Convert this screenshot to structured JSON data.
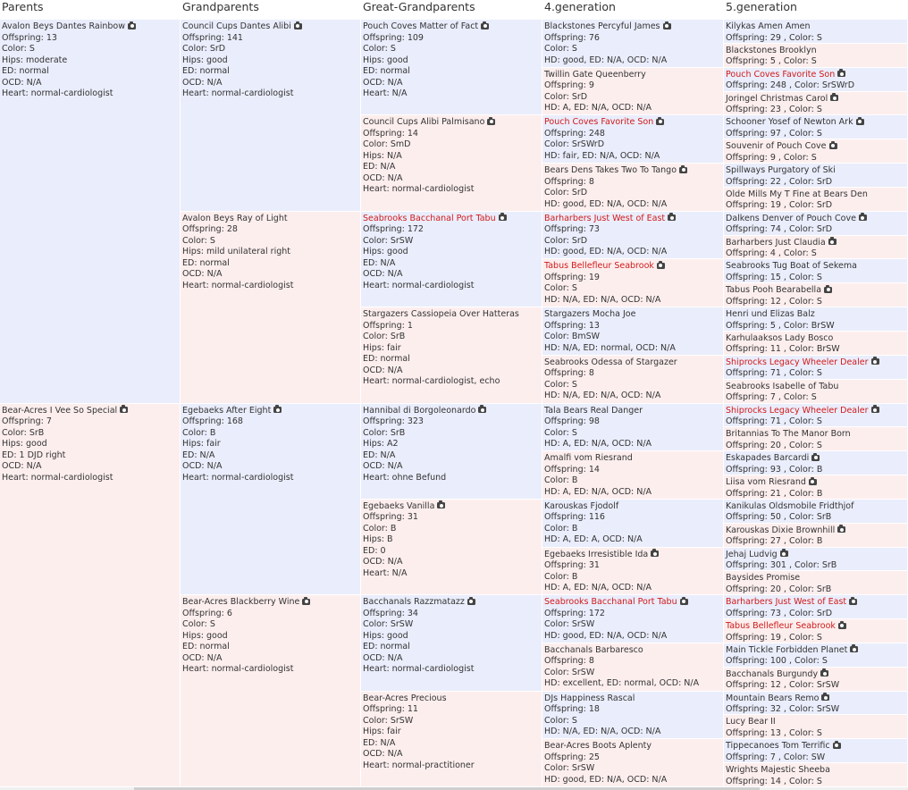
{
  "headers": [
    "Parents",
    "Grandparents",
    "Great-Grandparents",
    "4.generation",
    "5.generation"
  ],
  "gen1": [
    {
      "name": "Avalon Beys Dantes Rainbow",
      "photo": true,
      "red": false,
      "lines": [
        "Offspring: 13",
        "Color: S",
        "Hips: moderate",
        "ED: normal",
        "OCD: N/A",
        "Heart: normal-cardiologist"
      ]
    },
    {
      "name": "Bear-Acres I Vee So Special",
      "photo": true,
      "red": false,
      "lines": [
        "Offspring: 7",
        "Color: SrB",
        "Hips: good",
        "ED: 1 DJD right",
        "OCD: N/A",
        "Heart: normal-cardiologist"
      ]
    }
  ],
  "gen2": [
    {
      "name": "Council Cups Dantes Alibi",
      "photo": true,
      "red": false,
      "lines": [
        "Offspring: 141",
        "Color: SrD",
        "Hips: good",
        "ED: normal",
        "OCD: N/A",
        "Heart: normal-cardiologist"
      ]
    },
    {
      "name": "Avalon Beys Ray of Light",
      "photo": false,
      "red": false,
      "lines": [
        "Offspring: 28",
        "Color: S",
        "Hips: mild unilateral right",
        "ED: normal",
        "OCD: N/A",
        "Heart: normal-cardiologist"
      ]
    },
    {
      "name": "Egebaeks After Eight",
      "photo": true,
      "red": false,
      "lines": [
        "Offspring: 168",
        "Color: B",
        "Hips: fair",
        "ED: N/A",
        "OCD: N/A",
        "Heart: normal-cardiologist"
      ]
    },
    {
      "name": "Bear-Acres Blackberry Wine",
      "photo": true,
      "red": false,
      "lines": [
        "Offspring: 6",
        "Color: S",
        "Hips: good",
        "ED: normal",
        "OCD: N/A",
        "Heart: normal-cardiologist"
      ]
    }
  ],
  "gen3": [
    {
      "name": "Pouch Coves Matter of Fact",
      "photo": true,
      "red": false,
      "lines": [
        "Offspring: 109",
        "Color: S",
        "Hips: good",
        "ED: normal",
        "OCD: N/A",
        "Heart: N/A"
      ]
    },
    {
      "name": "Council Cups Alibi Palmisano",
      "photo": true,
      "red": false,
      "lines": [
        "Offspring: 14",
        "Color: SmD",
        "Hips: N/A",
        "ED: N/A",
        "OCD: N/A",
        "Heart: normal-cardiologist"
      ]
    },
    {
      "name": "Seabrooks Bacchanal Port Tabu",
      "photo": true,
      "red": true,
      "lines": [
        "Offspring: 172",
        "Color: SrSW",
        "Hips: good",
        "ED: N/A",
        "OCD: N/A",
        "Heart: normal-cardiologist"
      ]
    },
    {
      "name": "Stargazers Cassiopeia Over Hatteras",
      "photo": false,
      "red": false,
      "lines": [
        "Offspring: 1",
        "Color: SrB",
        "Hips: fair",
        "ED: normal",
        "OCD: N/A",
        "Heart: normal-cardiologist, echo"
      ]
    },
    {
      "name": "Hannibal di Borgoleonardo",
      "photo": true,
      "red": false,
      "lines": [
        "Offspring: 323",
        "Color: SrB",
        "Hips: A2",
        "ED: N/A",
        "OCD: N/A",
        "Heart: ohne Befund"
      ]
    },
    {
      "name": "Egebaeks Vanilla",
      "photo": true,
      "red": false,
      "lines": [
        "Offspring: 31",
        "Color: B",
        "Hips: B",
        "ED: 0",
        "OCD: N/A",
        "Heart: N/A"
      ]
    },
    {
      "name": "Bacchanals Razzmatazz",
      "photo": true,
      "red": false,
      "lines": [
        "Offspring: 34",
        "Color: SrSW",
        "Hips: good",
        "ED: normal",
        "OCD: N/A",
        "Heart: normal-cardiologist"
      ]
    },
    {
      "name": "Bear-Acres Precious",
      "photo": false,
      "red": false,
      "lines": [
        "Offspring: 11",
        "Color: SrSW",
        "Hips: fair",
        "ED: N/A",
        "OCD: N/A",
        "Heart: normal-practitioner"
      ]
    }
  ],
  "gen4": [
    {
      "name": "Blackstones Percyful James",
      "photo": true,
      "red": false,
      "lines": [
        "Offspring: 76",
        "Color: S",
        "HD: good, ED: N/A, OCD: N/A"
      ]
    },
    {
      "name": "Twillin Gate Queenberry",
      "photo": false,
      "red": false,
      "lines": [
        "Offspring: 9",
        "Color: SrD",
        "HD: A, ED: N/A, OCD: N/A"
      ]
    },
    {
      "name": "Pouch Coves Favorite Son",
      "photo": true,
      "red": true,
      "lines": [
        "Offspring: 248",
        "Color: SrSWrD",
        "HD: fair, ED: N/A, OCD: N/A"
      ]
    },
    {
      "name": "Bears Dens Takes Two To Tango",
      "photo": true,
      "red": false,
      "lines": [
        "Offspring: 8",
        "Color: SrD",
        "HD: good, ED: N/A, OCD: N/A"
      ]
    },
    {
      "name": "Barharbers Just West of East",
      "photo": true,
      "red": true,
      "lines": [
        "Offspring: 73",
        "Color: SrD",
        "HD: good, ED: N/A, OCD: N/A"
      ]
    },
    {
      "name": "Tabus Bellefleur Seabrook",
      "photo": true,
      "red": true,
      "lines": [
        "Offspring: 19",
        "Color: S",
        "HD: N/A, ED: N/A, OCD: N/A"
      ]
    },
    {
      "name": "Stargazers Mocha Joe",
      "photo": false,
      "red": false,
      "lines": [
        "Offspring: 13",
        "Color: BmSW",
        "HD: N/A, ED: normal, OCD: N/A"
      ]
    },
    {
      "name": "Seabrooks Odessa of Stargazer",
      "photo": false,
      "red": false,
      "lines": [
        "Offspring: 8",
        "Color: S",
        "HD: N/A, ED: N/A, OCD: N/A"
      ]
    },
    {
      "name": "Tala Bears Real Danger",
      "photo": false,
      "red": false,
      "lines": [
        "Offspring: 98",
        "Color: S",
        "HD: A, ED: N/A, OCD: N/A"
      ]
    },
    {
      "name": "Amalfi vom Riesrand",
      "photo": false,
      "red": false,
      "lines": [
        "Offspring: 14",
        "Color: B",
        "HD: A, ED: N/A, OCD: N/A"
      ]
    },
    {
      "name": "Karouskas Fjodolf",
      "photo": false,
      "red": false,
      "lines": [
        "Offspring: 116",
        "Color: B",
        "HD: A, ED: A, OCD: N/A"
      ]
    },
    {
      "name": "Egebaeks Irresistible Ida",
      "photo": true,
      "red": false,
      "lines": [
        "Offspring: 31",
        "Color: B",
        "HD: A, ED: N/A, OCD: N/A"
      ]
    },
    {
      "name": "Seabrooks Bacchanal Port Tabu",
      "photo": true,
      "red": true,
      "lines": [
        "Offspring: 172",
        "Color: SrSW",
        "HD: good, ED: N/A, OCD: N/A"
      ]
    },
    {
      "name": "Bacchanals Barbaresco",
      "photo": false,
      "red": false,
      "lines": [
        "Offspring: 8",
        "Color: SrSW",
        "HD: excellent, ED: normal, OCD: N/A"
      ]
    },
    {
      "name": "DJs Happiness Rascal",
      "photo": false,
      "red": false,
      "lines": [
        "Offspring: 18",
        "Color: S",
        "HD: N/A, ED: N/A, OCD: N/A"
      ]
    },
    {
      "name": "Bear-Acres Boots Aplenty",
      "photo": false,
      "red": false,
      "lines": [
        "Offspring: 25",
        "Color: SrSW",
        "HD: good, ED: N/A, OCD: N/A"
      ]
    }
  ],
  "gen5": [
    {
      "name": "Kilykas Amen Amen",
      "photo": false,
      "red": false,
      "lines": [
        "Offspring: 29 , Color: S"
      ]
    },
    {
      "name": "Blackstones Brooklyn",
      "photo": false,
      "red": false,
      "lines": [
        "Offspring: 5 , Color: S"
      ]
    },
    {
      "name": "Pouch Coves Favorite Son",
      "photo": true,
      "red": true,
      "lines": [
        "Offspring: 248 , Color: SrSWrD"
      ]
    },
    {
      "name": "Joringel Christmas Carol",
      "photo": true,
      "red": false,
      "lines": [
        "Offspring: 23 , Color: S"
      ]
    },
    {
      "name": "Schooner Yosef of Newton Ark",
      "photo": true,
      "red": false,
      "lines": [
        "Offspring: 97 , Color: S"
      ]
    },
    {
      "name": "Souvenir of Pouch Cove",
      "photo": true,
      "red": false,
      "lines": [
        "Offspring: 9 , Color: S"
      ]
    },
    {
      "name": "Spillways Purgatory of Ski",
      "photo": false,
      "red": false,
      "lines": [
        "Offspring: 22 , Color: SrD"
      ]
    },
    {
      "name": "Olde Mills My T Fine at Bears Den",
      "photo": false,
      "red": false,
      "lines": [
        "Offspring: 19 , Color: SrD"
      ]
    },
    {
      "name": "Dalkens Denver of Pouch Cove",
      "photo": true,
      "red": false,
      "lines": [
        "Offspring: 74 , Color: SrD"
      ]
    },
    {
      "name": "Barharbers Just Claudia",
      "photo": true,
      "red": false,
      "lines": [
        "Offspring: 4 , Color: S"
      ]
    },
    {
      "name": "Seabrooks Tug Boat of Sekema",
      "photo": false,
      "red": false,
      "lines": [
        "Offspring: 15 , Color: S"
      ]
    },
    {
      "name": "Tabus Pooh Bearabella",
      "photo": true,
      "red": false,
      "lines": [
        "Offspring: 12 , Color: S"
      ]
    },
    {
      "name": "Henri und Elizas Balz",
      "photo": false,
      "red": false,
      "lines": [
        "Offspring: 5 , Color: BrSW"
      ]
    },
    {
      "name": "Karhulaaksos Lady Bosco",
      "photo": false,
      "red": false,
      "lines": [
        "Offspring: 11 , Color: BrSW"
      ]
    },
    {
      "name": "Shiprocks Legacy Wheeler Dealer",
      "photo": true,
      "red": true,
      "lines": [
        "Offspring: 71 , Color: S"
      ]
    },
    {
      "name": "Seabrooks Isabelle of Tabu",
      "photo": false,
      "red": false,
      "lines": [
        "Offspring: 7 , Color: S"
      ]
    },
    {
      "name": "Shiprocks Legacy Wheeler Dealer",
      "photo": true,
      "red": true,
      "lines": [
        "Offspring: 71 , Color: S"
      ]
    },
    {
      "name": "Britannias To The Manor Born",
      "photo": false,
      "red": false,
      "lines": [
        "Offspring: 20 , Color: S"
      ]
    },
    {
      "name": "Eskapades Barcardi",
      "photo": true,
      "red": false,
      "lines": [
        "Offspring: 93 , Color: B"
      ]
    },
    {
      "name": "Liisa vom Riesrand",
      "photo": true,
      "red": false,
      "lines": [
        "Offspring: 21 , Color: B"
      ]
    },
    {
      "name": "Kanikulas Oldsmobile Fridthjof",
      "photo": false,
      "red": false,
      "lines": [
        "Offspring: 50 , Color: SrB"
      ]
    },
    {
      "name": "Karouskas Dixie Brownhill",
      "photo": true,
      "red": false,
      "lines": [
        "Offspring: 27 , Color: B"
      ]
    },
    {
      "name": "Jehaj Ludvig",
      "photo": true,
      "red": false,
      "lines": [
        "Offspring: 301 , Color: SrB"
      ]
    },
    {
      "name": "Baysides Promise",
      "photo": false,
      "red": false,
      "lines": [
        "Offspring: 20 , Color: SrB"
      ]
    },
    {
      "name": "Barharbers Just West of East",
      "photo": true,
      "red": true,
      "lines": [
        "Offspring: 73 , Color: SrD"
      ]
    },
    {
      "name": "Tabus Bellefleur Seabrook",
      "photo": true,
      "red": true,
      "lines": [
        "Offspring: 19 , Color: S"
      ]
    },
    {
      "name": "Main Tickle Forbidden Planet",
      "photo": true,
      "red": false,
      "lines": [
        "Offspring: 100 , Color: S"
      ]
    },
    {
      "name": "Bacchanals Burgundy",
      "photo": true,
      "red": false,
      "lines": [
        "Offspring: 12 , Color: SrSW"
      ]
    },
    {
      "name": "Mountain Bears Remo",
      "photo": true,
      "red": false,
      "lines": [
        "Offspring: 32 , Color: SrSW"
      ]
    },
    {
      "name": "Lucy Bear II",
      "photo": false,
      "red": false,
      "lines": [
        "Offspring: 13 , Color: S"
      ]
    },
    {
      "name": "Tippecanoes Tom Terrific",
      "photo": true,
      "red": false,
      "lines": [
        "Offspring: 7 , Color: SW"
      ]
    },
    {
      "name": "Wrights Majestic Sheeba",
      "photo": false,
      "red": false,
      "lines": [
        "Offspring: 14 , Color: S"
      ]
    }
  ],
  "colors": {
    "male_bg": "#eaedfb",
    "female_bg": "#fdeeee",
    "highlight_text": "#d11a1a"
  },
  "icons": {
    "photo": "camera-icon"
  }
}
